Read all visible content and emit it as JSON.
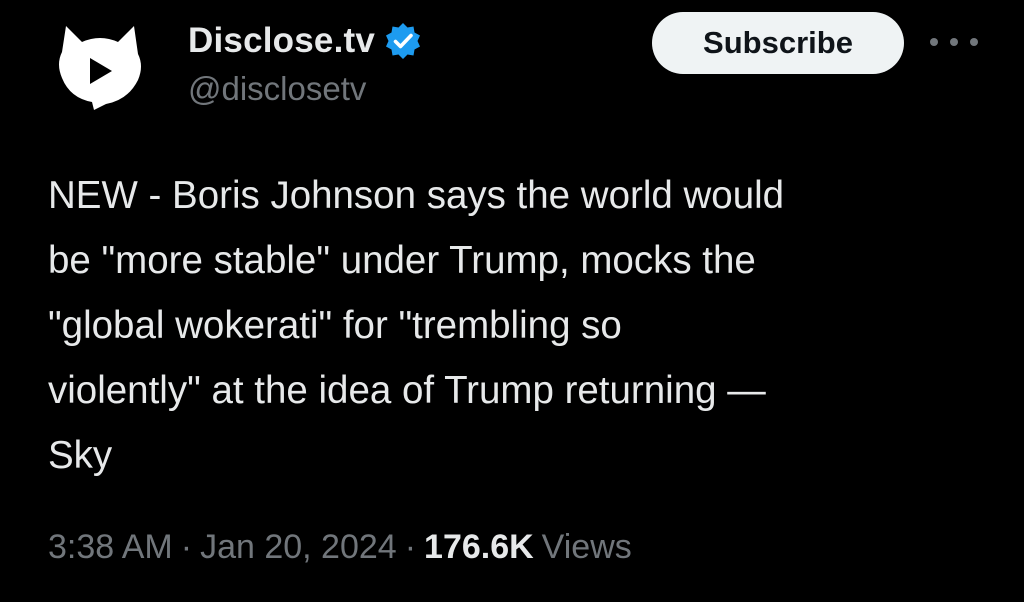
{
  "account": {
    "display_name": "Disclose.tv",
    "handle": "@disclosetv",
    "verified": true,
    "avatar_icon": "play-bubble-logo-icon",
    "verified_icon": "verified-badge-icon"
  },
  "actions": {
    "subscribe_label": "Subscribe",
    "more_icon": "more-options-icon"
  },
  "tweet": {
    "text": "NEW - Boris Johnson says the world would\nbe \"more stable\" under Trump, mocks the\n\"global wokerati\" for \"trembling so\nviolently\" at the idea of Trump returning —\nSky"
  },
  "meta": {
    "time": "3:38 AM",
    "date": "Jan 20, 2024",
    "separator": "·",
    "views_count": "176.6K",
    "views_label": "Views"
  },
  "colors": {
    "background": "#000000",
    "primary_text": "#e7e9ea",
    "secondary_text": "#71767b",
    "verified_blue": "#1d9bf0",
    "button_bg": "#eff3f4",
    "button_text": "#0f1419"
  }
}
